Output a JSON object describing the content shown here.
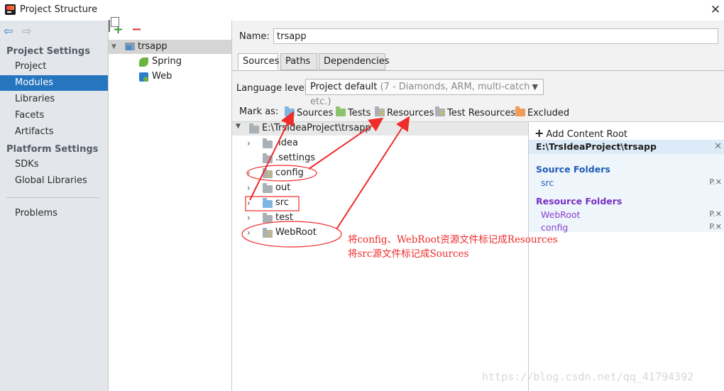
{
  "window": {
    "title": "Project Structure",
    "close": "✕"
  },
  "nav": {
    "back": "⇦",
    "forward": "⇨",
    "project_settings": "Project Settings",
    "project_items": [
      "Project",
      "Modules",
      "Libraries",
      "Facets",
      "Artifacts"
    ],
    "platform_settings": "Platform Settings",
    "platform_items": [
      "SDKs",
      "Global Libraries"
    ],
    "problems": "Problems",
    "selected": "Modules"
  },
  "modules": {
    "toolbar": {
      "add": "+",
      "remove": "−"
    },
    "tree": [
      {
        "label": "trsapp",
        "icon": "module-icon",
        "expanded": true
      },
      {
        "label": "Spring",
        "icon": "spring-icon"
      },
      {
        "label": "Web",
        "icon": "web-icon"
      }
    ]
  },
  "main": {
    "name_label": "Name:",
    "name_value": "trsapp",
    "tabs": [
      "Sources",
      "Paths",
      "Dependencies"
    ],
    "active_tab": "Sources",
    "language_level_label": "Language level:",
    "language_level_value": "Project default",
    "language_level_hint": "(7 - Diamonds, ARM, multi-catch etc.)",
    "mark_as_label": "Mark as:",
    "mark_as": [
      "Sources",
      "Tests",
      "Resources",
      "Test Resources",
      "Excluded"
    ]
  },
  "content_tree": {
    "root": "E:\\TrsIdeaProject\\trsapp",
    "children": [
      ".idea",
      ".settings",
      "config",
      "out",
      "src",
      "test",
      "WebRoot"
    ]
  },
  "content_root": {
    "add_label": "Add Content Root",
    "path": "E:\\TrsIdeaProject\\trsapp",
    "source_header": "Source Folders",
    "source_folders": [
      "src"
    ],
    "resource_header": "Resource Folders",
    "resource_folders": [
      "WebRoot",
      "config"
    ]
  },
  "annotations": {
    "line1": "将config、WebRoot资源文件标记成Resources",
    "line2": "将src源文件标记成Sources",
    "color": "#ef2b2b"
  },
  "watermark": "https://blog.csdn.net/qq_41794392"
}
